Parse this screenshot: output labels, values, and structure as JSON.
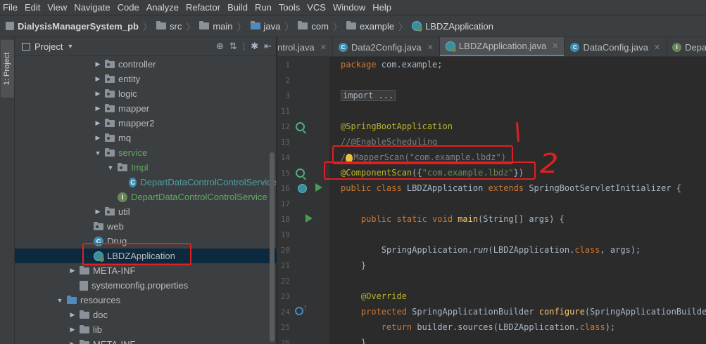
{
  "menu": [
    "File",
    "Edit",
    "View",
    "Navigate",
    "Code",
    "Analyze",
    "Refactor",
    "Build",
    "Run",
    "Tools",
    "VCS",
    "Window",
    "Help"
  ],
  "breadcrumb": {
    "project": "DialysisManagerSystem_pb",
    "items": [
      "src",
      "main",
      "java",
      "com",
      "example"
    ],
    "file": "LBDZApplication"
  },
  "left_stripe": {
    "tab_label": "1: Project"
  },
  "project_panel": {
    "title": "Project",
    "tree": [
      {
        "label": "controller",
        "kind": "package",
        "arrow": "closed",
        "indent": 112,
        "color": "normal"
      },
      {
        "label": "entity",
        "kind": "package",
        "arrow": "closed",
        "indent": 112,
        "color": "normal"
      },
      {
        "label": "logic",
        "kind": "package",
        "arrow": "closed",
        "indent": 112,
        "color": "normal"
      },
      {
        "label": "mapper",
        "kind": "package",
        "arrow": "closed",
        "indent": 112,
        "color": "normal"
      },
      {
        "label": "mapper2",
        "kind": "package",
        "arrow": "closed",
        "indent": 112,
        "color": "normal"
      },
      {
        "label": "mq",
        "kind": "package",
        "arrow": "closed",
        "indent": 112,
        "color": "normal"
      },
      {
        "label": "service",
        "kind": "package",
        "arrow": "open",
        "indent": 112,
        "color": "green"
      },
      {
        "label": "Impl",
        "kind": "package",
        "arrow": "open",
        "indent": 130,
        "color": "green"
      },
      {
        "label": "DepartDataControlControlService",
        "kind": "class",
        "arrow": "none",
        "indent": 148,
        "color": "teal"
      },
      {
        "label": "DepartDataControlControlService",
        "kind": "interface",
        "arrow": "none",
        "indent": 130,
        "color": "green"
      },
      {
        "label": "util",
        "kind": "package",
        "arrow": "closed",
        "indent": 112,
        "color": "normal"
      },
      {
        "label": "web",
        "kind": "package",
        "arrow": "none",
        "indent": 96,
        "color": "normal"
      },
      {
        "label": "Drug",
        "kind": "class",
        "arrow": "none",
        "indent": 96,
        "color": "normal"
      },
      {
        "label": "LBDZApplication",
        "kind": "app",
        "arrow": "none",
        "indent": 96,
        "color": "normal",
        "selected": true
      },
      {
        "label": "META-INF",
        "kind": "folder",
        "arrow": "closed",
        "indent": 76,
        "color": "normal"
      },
      {
        "label": "systemconfig.properties",
        "kind": "file",
        "arrow": "none",
        "indent": 76,
        "color": "normal"
      },
      {
        "label": "resources",
        "kind": "folder-blue",
        "arrow": "open",
        "indent": 58,
        "color": "normal"
      },
      {
        "label": "doc",
        "kind": "folder",
        "arrow": "closed",
        "indent": 76,
        "color": "normal"
      },
      {
        "label": "lib",
        "kind": "folder",
        "arrow": "closed",
        "indent": 76,
        "color": "normal"
      },
      {
        "label": "META-INF",
        "kind": "folder",
        "arrow": "closed",
        "indent": 76,
        "color": "normal"
      }
    ]
  },
  "tabs": [
    {
      "label": "ntrol.java",
      "icon": "none",
      "active": false
    },
    {
      "label": "Data2Config.java",
      "icon": "class",
      "active": false
    },
    {
      "label": "LBDZApplication.java",
      "icon": "app",
      "active": true
    },
    {
      "label": "DataConfig.java",
      "icon": "class",
      "active": false
    },
    {
      "label": "DepartD",
      "icon": "interface",
      "active": false
    }
  ],
  "line_numbers": [
    "1",
    "2",
    "3",
    "11",
    "12",
    "13",
    "14",
    "15",
    "16",
    "17",
    "18",
    "19",
    "20",
    "21",
    "22",
    "23",
    "24",
    "25",
    "26"
  ],
  "code": {
    "l1_kw": "package",
    "l1_rest": " com.example;",
    "l3_folded": "import ...",
    "l12": "@SpringBootApplication",
    "l13": "//@EnableScheduling",
    "l14_a": "/",
    "l14_b": "MapperScan(\"com.example.lbdz\")",
    "l15_a": "@ComponentScan",
    "l15_b": "({",
    "l15_c": "\"com.example.lbdz\"",
    "l15_d": "})",
    "l16_kw1": "public class",
    "l16_name": " LBDZApplication ",
    "l16_kw2": "extends",
    "l16_rest": " SpringBootServletInitializer {",
    "l18_kw": "public static void",
    "l18_fn": " main",
    "l18_rest": "(String[] args) {",
    "l20_a": "SpringApplication.",
    "l20_fn": "run",
    "l20_b": "(LBDZApplication.",
    "l20_kw": "class",
    "l20_c": ", args);",
    "l21": "}",
    "l23": "@Override",
    "l24_kw": "protected",
    "l24_a": " SpringApplicationBuilder ",
    "l24_fn": "configure",
    "l24_b": "(SpringApplicationBuilder",
    "l25_kw": "return",
    "l25_a": " builder.sources(LBDZApplication.",
    "l25_kw2": "class",
    "l25_b": ");",
    "l26": "}"
  },
  "annotations": {
    "mark1": "1",
    "mark2": "2"
  }
}
